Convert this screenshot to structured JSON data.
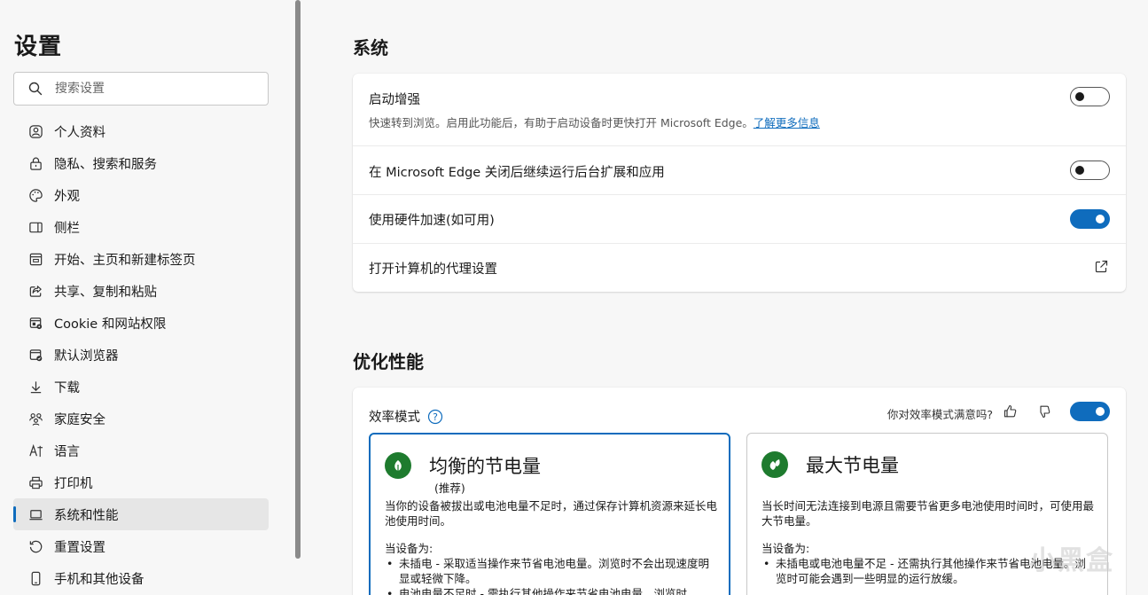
{
  "sidebar": {
    "title": "设置",
    "search_placeholder": "搜索设置",
    "items": [
      {
        "label": "个人资料",
        "icon": "profile-icon"
      },
      {
        "label": "隐私、搜索和服务",
        "icon": "lock-icon"
      },
      {
        "label": "外观",
        "icon": "palette-icon"
      },
      {
        "label": "侧栏",
        "icon": "sidebar-icon"
      },
      {
        "label": "开始、主页和新建标签页",
        "icon": "home-icon"
      },
      {
        "label": "共享、复制和粘贴",
        "icon": "share-icon"
      },
      {
        "label": "Cookie 和网站权限",
        "icon": "cookie-icon"
      },
      {
        "label": "默认浏览器",
        "icon": "browser-icon"
      },
      {
        "label": "下载",
        "icon": "download-icon"
      },
      {
        "label": "家庭安全",
        "icon": "family-icon"
      },
      {
        "label": "语言",
        "icon": "language-icon"
      },
      {
        "label": "打印机",
        "icon": "printer-icon"
      },
      {
        "label": "系统和性能",
        "icon": "laptop-icon",
        "active": true
      },
      {
        "label": "重置设置",
        "icon": "reset-icon"
      },
      {
        "label": "手机和其他设备",
        "icon": "phone-icon"
      }
    ]
  },
  "system": {
    "title": "系统",
    "startup_boost": {
      "label": "启动增强",
      "desc": "快速转到浏览。启用此功能后，有助于启动设备时更快打开 Microsoft Edge。",
      "link": "了解更多信息",
      "enabled": false
    },
    "background_run": {
      "label": "在 Microsoft Edge 关闭后继续运行后台扩展和应用",
      "enabled": false
    },
    "hardware_accel": {
      "label": "使用硬件加速(如可用)",
      "enabled": true
    },
    "proxy": {
      "label": "打开计算机的代理设置",
      "icon": "external-link-icon"
    }
  },
  "performance": {
    "title": "优化性能",
    "efficiency": {
      "label": "效率模式",
      "feedback": "你对效率模式满意吗?",
      "enabled": true
    },
    "balanced": {
      "title": "均衡的节电量",
      "subtitle": "(推荐)",
      "desc": "当你的设备被拔出或电池电量不足时，通过保存计算机资源来延长电池使用时间。",
      "when": "当设备为:",
      "bullets": [
        "未插电 - 采取适当操作来节省电池电量。浏览时不会出现速度明显或轻微下降。",
        "电池电量不足时 - 需执行其他操作来节省电池电量。浏览时"
      ]
    },
    "maximum": {
      "title": "最大节电量",
      "desc": "当长时间无法连接到电源且需要节省更多电池使用时间时，可使用最大节电量。",
      "when": "当设备为:",
      "bullets": [
        "未插电或电池电量不足 - 还需执行其他操作来节省电池电量。浏览时可能会遇到一些明显的运行放缓。"
      ]
    }
  },
  "watermark": "小黑盒",
  "colors": {
    "accent": "#0f6cbd",
    "leaf_green": "#1e7b2e"
  }
}
